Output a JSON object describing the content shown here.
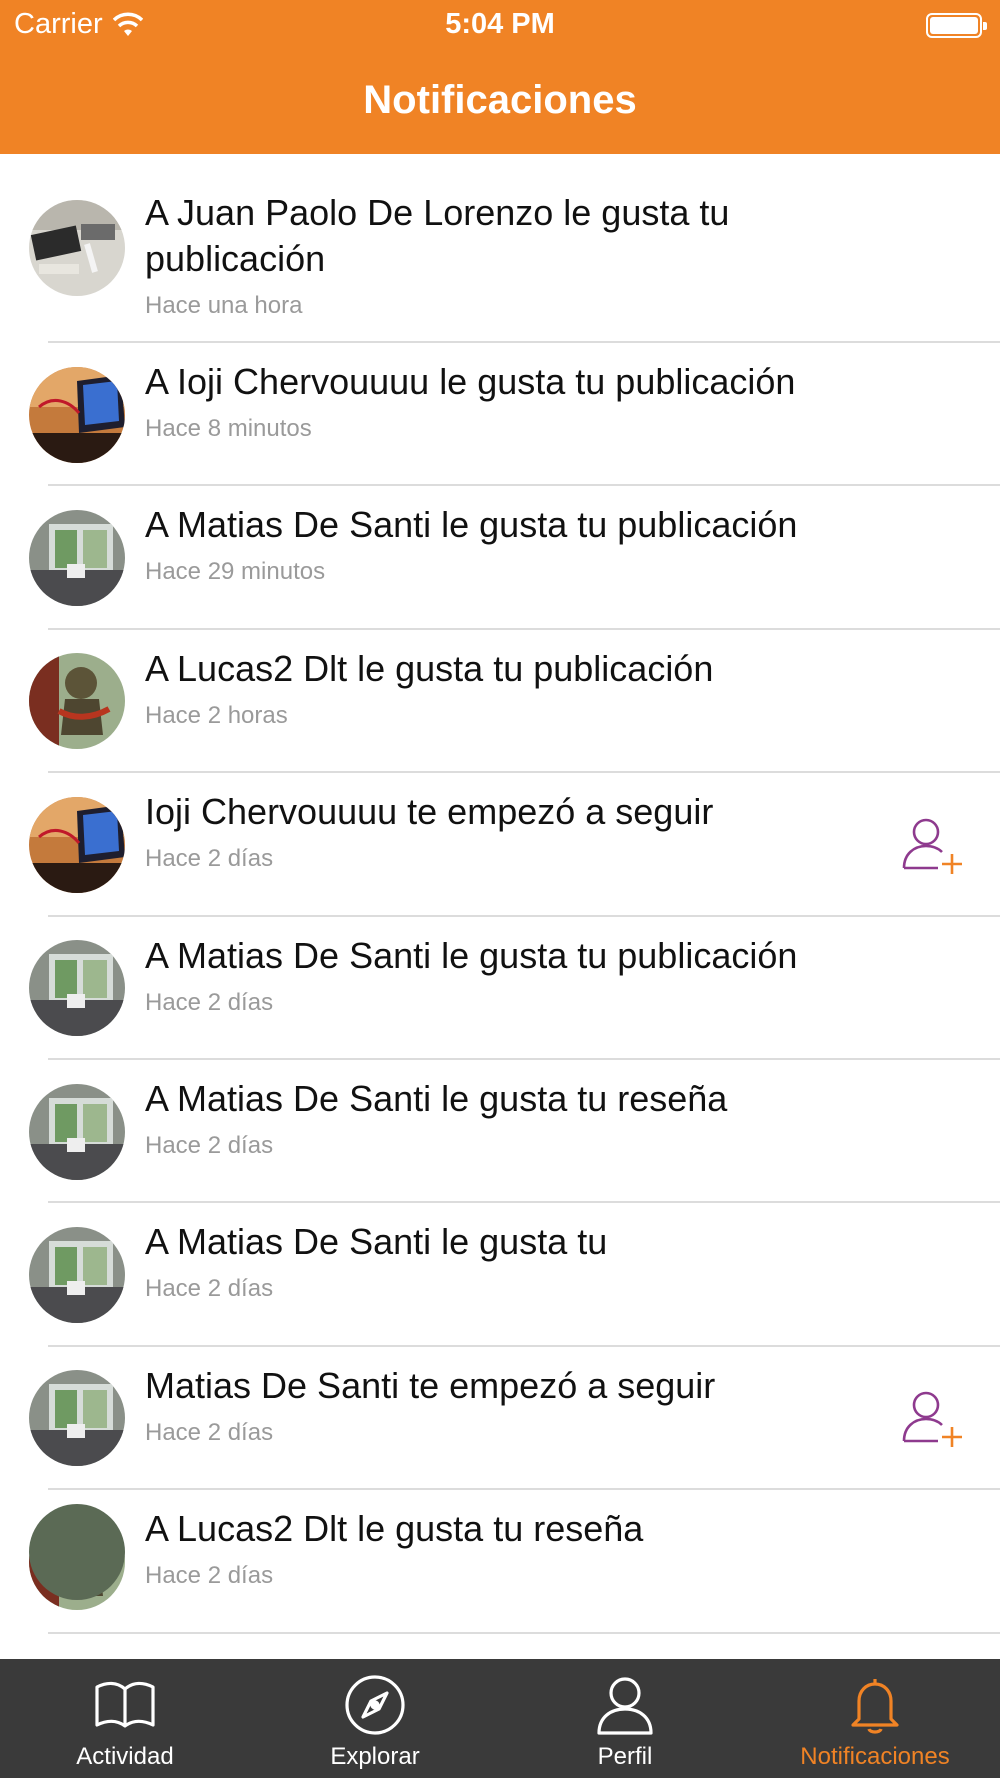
{
  "status_bar": {
    "carrier": "Carrier",
    "time": "5:04 PM"
  },
  "nav": {
    "title": "Notificaciones"
  },
  "notifications": [
    {
      "text": "A Juan Paolo De Lorenzo le gusta tu publicación",
      "time": "Hace una hora",
      "avatar": "desk-photo",
      "follow": false
    },
    {
      "text": "A Ioji Chervouuuu le gusta tu publicación",
      "time": "Hace 8 minutos",
      "avatar": "laptop-photo",
      "follow": false
    },
    {
      "text": "A Matias De Santi le gusta tu publicación",
      "time": "Hace 29 minutos",
      "avatar": "office-photo",
      "follow": false
    },
    {
      "text": "A Lucas2 Dlt le gusta tu publicación",
      "time": "Hace 2 horas",
      "avatar": "figurine-photo",
      "follow": false
    },
    {
      "text": "Ioji Chervouuuu te empezó a seguir",
      "time": "Hace 2 días",
      "avatar": "laptop-photo",
      "follow": true
    },
    {
      "text": "A Matias De Santi le gusta tu publicación",
      "time": "Hace 2 días",
      "avatar": "office-photo",
      "follow": false
    },
    {
      "text": "A Matias De Santi le gusta tu reseña",
      "time": "Hace 2 días",
      "avatar": "office-photo",
      "follow": false
    },
    {
      "text": "A Matias De Santi le gusta tu",
      "time": "Hace 2 días",
      "avatar": "office-photo",
      "follow": false
    },
    {
      "text": "Matias De Santi te empezó a seguir",
      "time": "Hace 2 días",
      "avatar": "office-photo",
      "follow": true
    },
    {
      "text": "A Lucas2 Dlt le gusta tu reseña",
      "time": "Hace 2 días",
      "avatar": "figurine-photo",
      "follow": false
    }
  ],
  "tabbar": {
    "tabs": [
      {
        "label": "Actividad",
        "icon": "book-icon",
        "active": false
      },
      {
        "label": "Explorar",
        "icon": "compass-icon",
        "active": false
      },
      {
        "label": "Perfil",
        "icon": "person-icon",
        "active": false
      },
      {
        "label": "Notificaciones",
        "icon": "bell-icon",
        "active": true
      }
    ]
  },
  "colors": {
    "accent": "#f08325",
    "tabbar_bg": "#3a3a3a",
    "secondary_text": "#9a9a9a",
    "follow_icon_person": "#8e3a8e",
    "follow_icon_plus": "#f08325"
  }
}
